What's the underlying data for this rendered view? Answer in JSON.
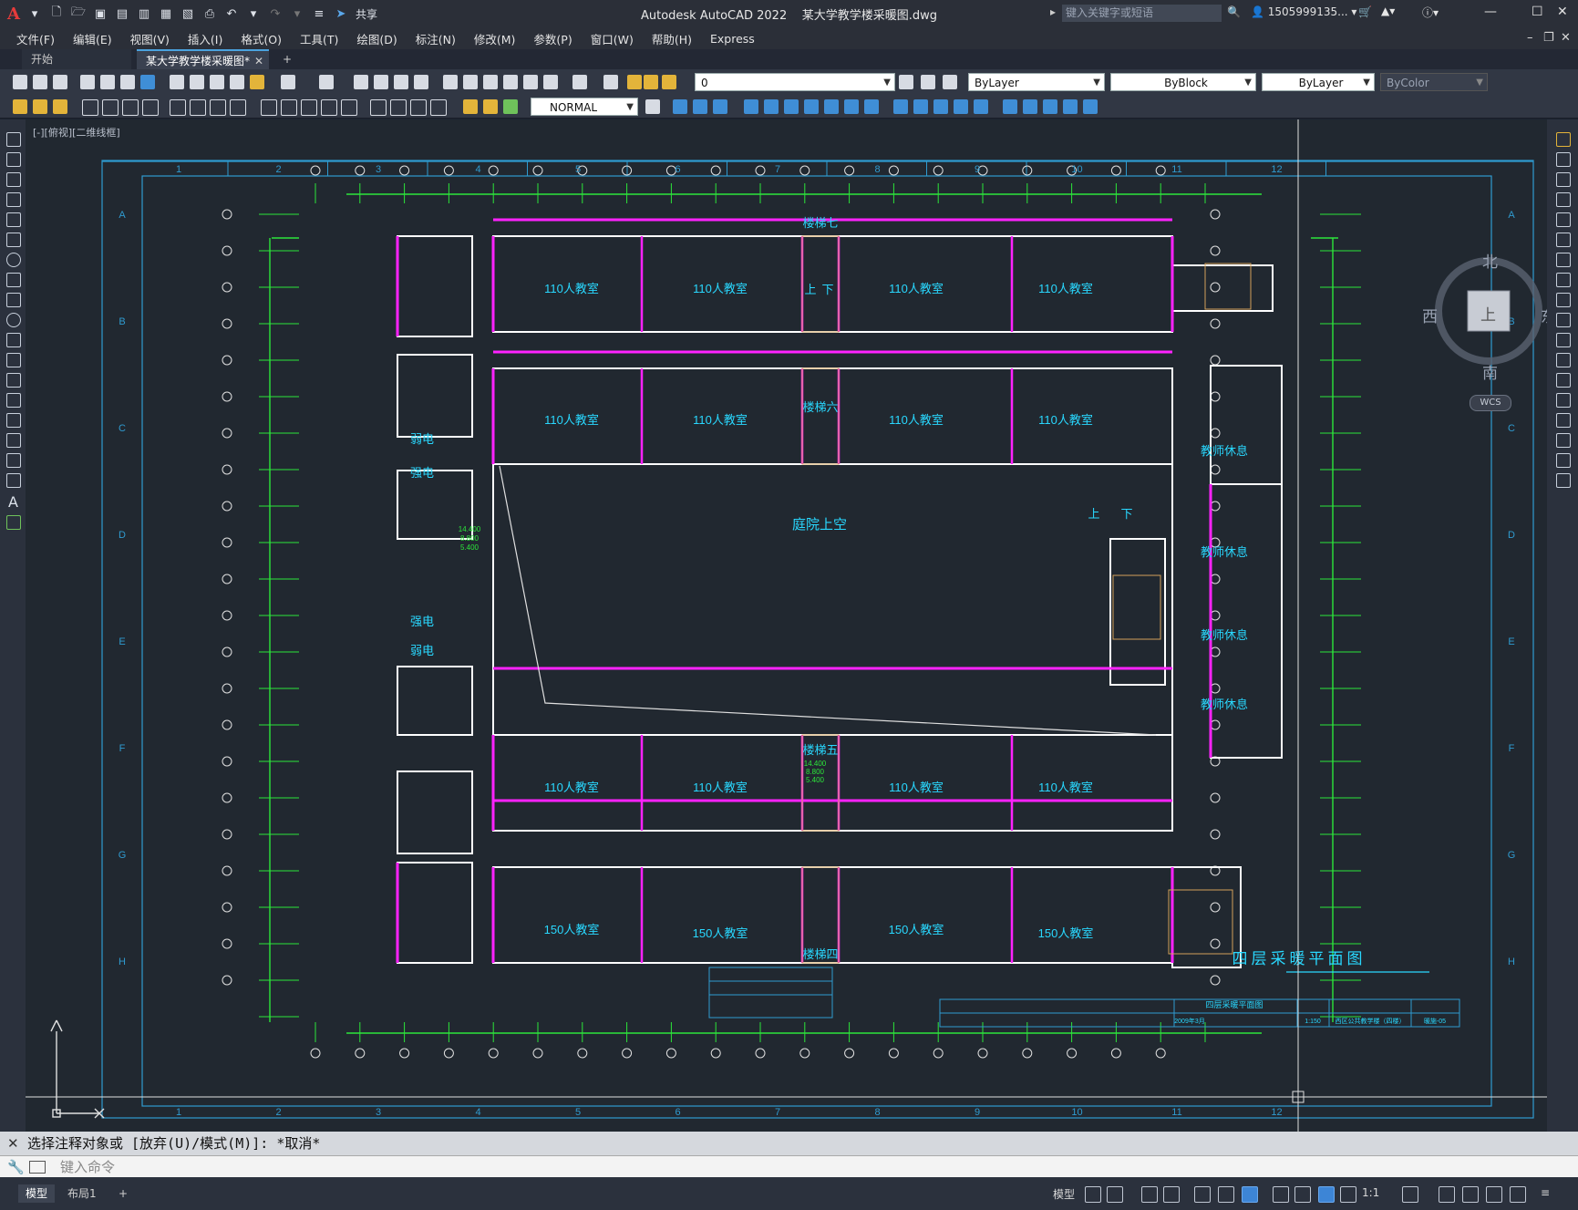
{
  "app": {
    "name": "Autodesk AutoCAD 2022",
    "file": "某大学教学楼采暖图.dwg",
    "logo": "A",
    "share_label": "共享",
    "search_placeholder": "键入关键字或短语",
    "user": "1505999135..."
  },
  "menus": [
    "文件(F)",
    "编辑(E)",
    "视图(V)",
    "插入(I)",
    "格式(O)",
    "工具(T)",
    "绘图(D)",
    "标注(N)",
    "修改(M)",
    "参数(P)",
    "窗口(W)",
    "帮助(H)",
    "Express"
  ],
  "tabs": {
    "start": "开始",
    "document": "某大学教学楼采暖图*",
    "add": "+"
  },
  "properties": {
    "layer": "0",
    "color": "ByLayer",
    "linetype": "ByBlock",
    "lineweight": "ByLayer",
    "plotstyle": "ByColor",
    "style": "NORMAL"
  },
  "viewport_label": "[-][俯视][二维线框]",
  "navcube": {
    "north": "北",
    "south": "南",
    "east": "东",
    "west": "西",
    "top": "上",
    "wcs": "WCS"
  },
  "drawing": {
    "sheet_title": "四层采暖平面图",
    "courtyard": "庭院上空",
    "classroom_110": "110人教室",
    "classroom_150": "150人教室",
    "teacher_lounge": "教师休息",
    "weak_current": "弱电",
    "strong_current": "强电",
    "stairs": [
      "楼梯七",
      "楼梯六",
      "楼梯五",
      "楼梯四"
    ],
    "stair_up": "上",
    "stair_down": "下",
    "elevations": [
      "14.400",
      "8.800",
      "5.400"
    ],
    "col_labels": [
      "1",
      "2",
      "3",
      "4",
      "5",
      "6",
      "7",
      "8",
      "9",
      "10",
      "11",
      "12"
    ],
    "row_labels": [
      "A",
      "B",
      "C",
      "D",
      "E",
      "F",
      "G",
      "H"
    ],
    "titleblock": {
      "date": "2009年3月",
      "drawing_name": "四层采暖平面图",
      "scale": "1:150",
      "project": "西区公共教学楼（四楼）",
      "sheet_no": "暖施-05"
    }
  },
  "command": {
    "history": "选择注释对象或 [放弃(U)/模式(M)]: *取消*",
    "placeholder": "键入命令"
  },
  "status": {
    "model_tab": "模型",
    "layout_tab": "布局1",
    "add": "+",
    "model_space": "模型",
    "scale": "1:1"
  }
}
